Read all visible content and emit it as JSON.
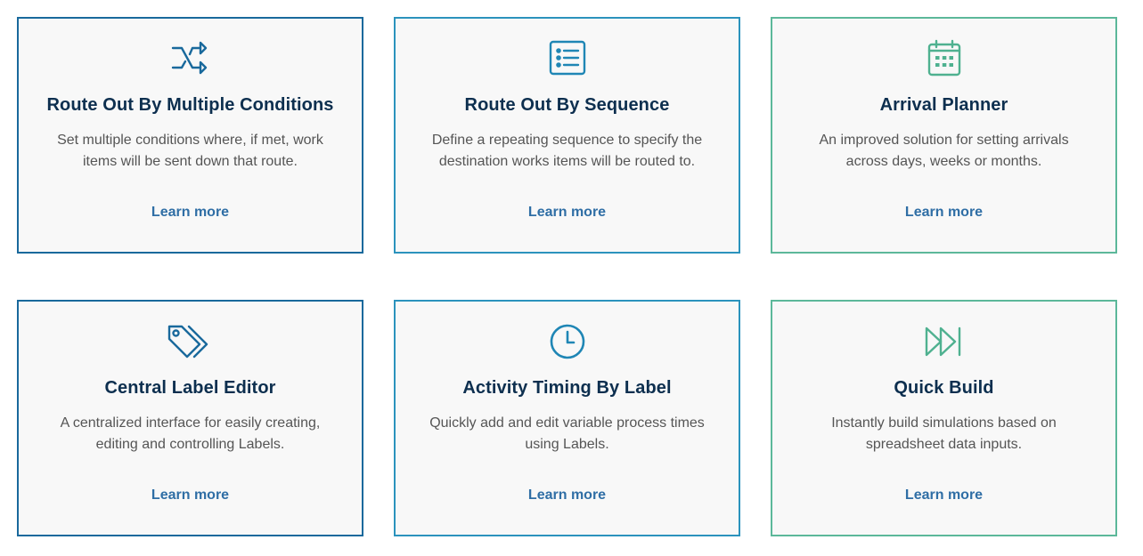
{
  "colors": {
    "col1": "#19699c",
    "col2": "#2b93bd",
    "col3": "#5cb89a",
    "title": "#0d2f4f",
    "link": "#2f6ea5"
  },
  "cards": [
    {
      "icon": "shuffle-icon",
      "title": "Route Out By Multiple Conditions",
      "description": "Set multiple conditions where, if met, work items will be sent down that route.",
      "link": "Learn more"
    },
    {
      "icon": "list-icon",
      "title": "Route Out By Sequence",
      "description": "Define a repeating sequence to specify the destination works items will be routed to.",
      "link": "Learn more"
    },
    {
      "icon": "calendar-icon",
      "title": "Arrival Planner",
      "description": "An improved solution for setting arrivals across days, weeks or months.",
      "link": "Learn more"
    },
    {
      "icon": "tags-icon",
      "title": "Central Label Editor",
      "description": "A centralized interface for easily creating, editing and controlling Labels.",
      "link": "Learn more"
    },
    {
      "icon": "clock-icon",
      "title": "Activity Timing By Label",
      "description": "Quickly add and edit variable process times using Labels.",
      "link": "Learn more"
    },
    {
      "icon": "fast-forward-icon",
      "title": "Quick Build",
      "description": "Instantly build simulations based on spreadsheet data inputs.",
      "link": "Learn more"
    }
  ]
}
